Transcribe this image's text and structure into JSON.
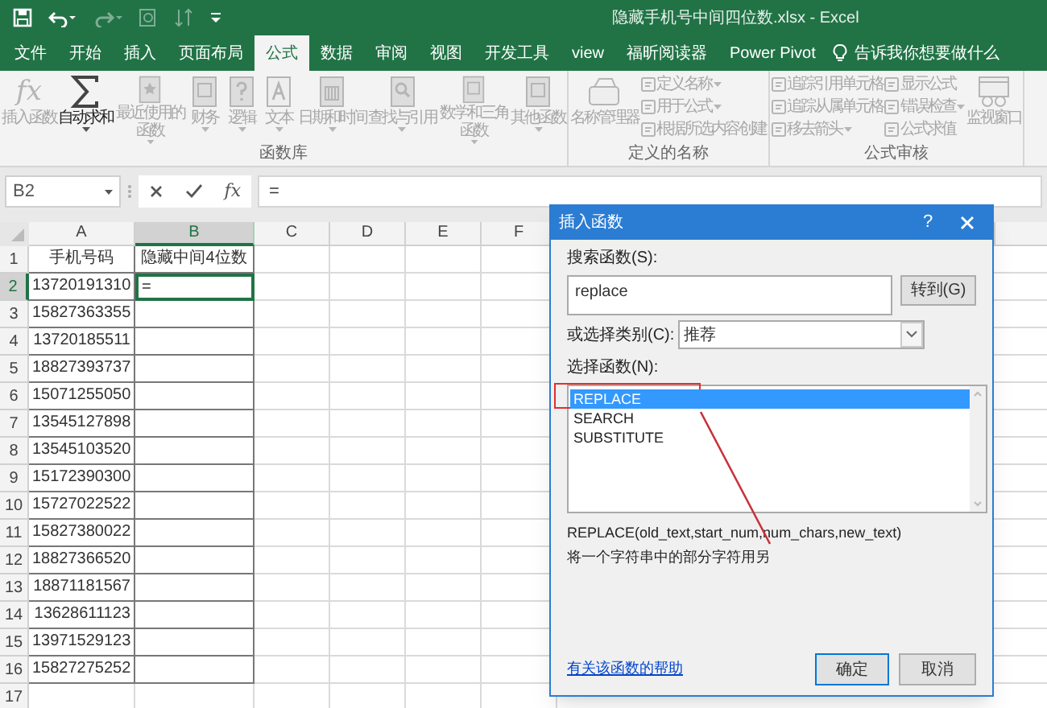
{
  "window": {
    "title": "隐藏手机号中间四位数.xlsx - Excel"
  },
  "ribbon_tabs": [
    {
      "label": "文件",
      "selected": false
    },
    {
      "label": "开始",
      "selected": false
    },
    {
      "label": "插入",
      "selected": false
    },
    {
      "label": "页面布局",
      "selected": false
    },
    {
      "label": "公式",
      "selected": true
    },
    {
      "label": "数据",
      "selected": false
    },
    {
      "label": "审阅",
      "selected": false
    },
    {
      "label": "视图",
      "selected": false
    },
    {
      "label": "开发工具",
      "selected": false
    },
    {
      "label": "view",
      "selected": false
    },
    {
      "label": "福昕阅读器",
      "selected": false
    },
    {
      "label": "Power Pivot",
      "selected": false
    }
  ],
  "tell_me": {
    "placeholder": "告诉我你想要做什么"
  },
  "ribbon": {
    "groups": [
      {
        "label": "函数库",
        "items": [
          {
            "kind": "large",
            "label": "插入函数",
            "icon_text": "fx",
            "disabled": true,
            "dropdown": false
          },
          {
            "kind": "large",
            "label": "自动求和",
            "disabled": false,
            "dropdown": true
          },
          {
            "kind": "large",
            "label": "最近使用的函数",
            "disabled": true,
            "dropdown": true
          },
          {
            "kind": "large",
            "label": "财务",
            "disabled": true,
            "dropdown": true
          },
          {
            "kind": "large",
            "label": "逻辑",
            "disabled": true,
            "dropdown": true
          },
          {
            "kind": "large",
            "label": "文本",
            "disabled": true,
            "dropdown": true
          },
          {
            "kind": "large",
            "label": "日期和时间",
            "disabled": true,
            "dropdown": true
          },
          {
            "kind": "large",
            "label": "查找与引用",
            "disabled": true,
            "dropdown": true
          },
          {
            "kind": "large",
            "label": "数学和三角函数",
            "disabled": true,
            "dropdown": true
          },
          {
            "kind": "large",
            "label": "其他函数",
            "disabled": true,
            "dropdown": true
          }
        ]
      },
      {
        "label": "定义的名称",
        "items": [
          {
            "kind": "large",
            "label": "名称管理器",
            "disabled": true,
            "dropdown": false
          },
          {
            "kind": "small_column",
            "buttons": [
              {
                "label": "定义名称",
                "disabled": true,
                "dropdown": true
              },
              {
                "label": "用于公式",
                "disabled": true,
                "dropdown": true
              },
              {
                "label": "根据所选内容创建",
                "disabled": true,
                "dropdown": false
              }
            ]
          }
        ]
      },
      {
        "label": "公式审核",
        "items": [
          {
            "kind": "small_column",
            "buttons": [
              {
                "label": "追踪引用单元格",
                "disabled": true,
                "dropdown": false
              },
              {
                "label": "追踪从属单元格",
                "disabled": true,
                "dropdown": false
              },
              {
                "label": "移去箭头",
                "disabled": true,
                "dropdown": true
              }
            ]
          },
          {
            "kind": "small_column",
            "buttons": [
              {
                "label": "显示公式",
                "disabled": true,
                "dropdown": false
              },
              {
                "label": "错误检查",
                "disabled": true,
                "dropdown": true
              },
              {
                "label": "公式求值",
                "disabled": true,
                "dropdown": false
              }
            ]
          },
          {
            "kind": "large",
            "label": "监视窗口",
            "disabled": true,
            "dropdown": false
          }
        ]
      }
    ]
  },
  "formula_bar": {
    "name_box": "B2",
    "fx_button": "fx",
    "formula": "="
  },
  "sheet": {
    "columns": [
      {
        "label": "A",
        "selected": false
      },
      {
        "label": "B",
        "selected": true
      },
      {
        "label": "C",
        "selected": false
      },
      {
        "label": "D",
        "selected": false
      },
      {
        "label": "E",
        "selected": false
      },
      {
        "label": "F",
        "selected": false
      }
    ],
    "rows": [
      {
        "number": "1",
        "selected": false,
        "cells": [
          {
            "text": "手机号码",
            "selected": false
          },
          {
            "text": "隐藏中间4位数",
            "selected": false
          }
        ]
      },
      {
        "number": "2",
        "selected": true,
        "cells": [
          {
            "text": "13720191310",
            "selected": false
          },
          {
            "text": "=",
            "selected": true
          }
        ]
      },
      {
        "number": "3",
        "selected": false,
        "cells": [
          {
            "text": "15827363355",
            "selected": false
          },
          {
            "selected": false
          }
        ]
      },
      {
        "number": "4",
        "selected": false,
        "cells": [
          {
            "text": "13720185511",
            "selected": false
          },
          {
            "selected": false
          }
        ]
      },
      {
        "number": "5",
        "selected": false,
        "cells": [
          {
            "text": "18827393737",
            "selected": false
          },
          {
            "selected": false
          }
        ]
      },
      {
        "number": "6",
        "selected": false,
        "cells": [
          {
            "text": "15071255050",
            "selected": false
          },
          {
            "selected": false
          }
        ]
      },
      {
        "number": "7",
        "selected": false,
        "cells": [
          {
            "text": "13545127898",
            "selected": false
          },
          {
            "selected": false
          }
        ]
      },
      {
        "number": "8",
        "selected": false,
        "cells": [
          {
            "text": "13545103520",
            "selected": false
          },
          {
            "selected": false
          }
        ]
      },
      {
        "number": "9",
        "selected": false,
        "cells": [
          {
            "text": "15172390300",
            "selected": false
          },
          {
            "selected": false
          }
        ]
      },
      {
        "number": "10",
        "selected": false,
        "cells": [
          {
            "text": "15727022522",
            "selected": false
          },
          {
            "selected": false
          }
        ]
      },
      {
        "number": "11",
        "selected": false,
        "cells": [
          {
            "text": "15827380022",
            "selected": false
          },
          {
            "selected": false
          }
        ]
      },
      {
        "number": "12",
        "selected": false,
        "cells": [
          {
            "text": "18827366520",
            "selected": false
          },
          {
            "selected": false
          }
        ]
      },
      {
        "number": "13",
        "selected": false,
        "cells": [
          {
            "text": "18871181567",
            "selected": false
          },
          {
            "selected": false
          }
        ]
      },
      {
        "number": "14",
        "selected": false,
        "cells": [
          {
            "text": "13628611123",
            "selected": false
          },
          {
            "selected": false
          }
        ]
      },
      {
        "number": "15",
        "selected": false,
        "cells": [
          {
            "text": "13971529123",
            "selected": false
          },
          {
            "selected": false
          }
        ]
      },
      {
        "number": "16",
        "selected": false,
        "cells": [
          {
            "text": "15827275252",
            "selected": false
          },
          {
            "selected": false
          }
        ]
      },
      {
        "number": "17",
        "selected": false
      }
    ]
  },
  "dialog": {
    "title": "插入函数",
    "help_button": "?",
    "search_label": "搜索函数(S):",
    "search": {
      "value": "replace"
    },
    "go_button": "转到(G)",
    "category_label": "或选择类别(C):",
    "category": {
      "value": "推荐"
    },
    "list_label": "选择函数(N):",
    "functions": [
      {
        "name": "REPLACE",
        "selected": true
      },
      {
        "name": "SEARCH",
        "selected": false
      },
      {
        "name": "SUBSTITUTE",
        "selected": false
      }
    ],
    "signature": "REPLACE(old_text,start_num,num_chars,new_text)",
    "description": "将一个字符串中的部分字符用另",
    "help_link": "有关该函数的帮助",
    "buttons": [
      "确定",
      "取消"
    ]
  }
}
